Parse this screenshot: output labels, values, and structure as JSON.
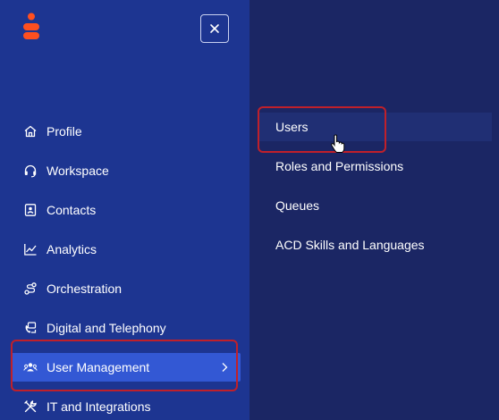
{
  "header": {
    "close_icon": "close-icon",
    "logo": "genesys-logo"
  },
  "nav": {
    "items": [
      {
        "label": "Profile",
        "icon": "home-icon"
      },
      {
        "label": "Workspace",
        "icon": "headset-icon"
      },
      {
        "label": "Contacts",
        "icon": "contact-card-icon"
      },
      {
        "label": "Analytics",
        "icon": "line-chart-icon"
      },
      {
        "label": "Orchestration",
        "icon": "flow-icon"
      },
      {
        "label": "Digital and Telephony",
        "icon": "phone-chat-icon"
      },
      {
        "label": "User Management",
        "icon": "users-icon",
        "active": true
      },
      {
        "label": "IT and Integrations",
        "icon": "tools-icon"
      }
    ]
  },
  "submenu": {
    "items": [
      {
        "label": "Users"
      },
      {
        "label": "Roles and Permissions"
      },
      {
        "label": "Queues"
      },
      {
        "label": "ACD Skills and Languages"
      }
    ]
  },
  "colors": {
    "nav_bg": "#1d3591",
    "submenu_bg": "#1b2664",
    "active_bg": "#3358d4",
    "brand": "#ff4f1f",
    "highlight": "#c0202a"
  }
}
